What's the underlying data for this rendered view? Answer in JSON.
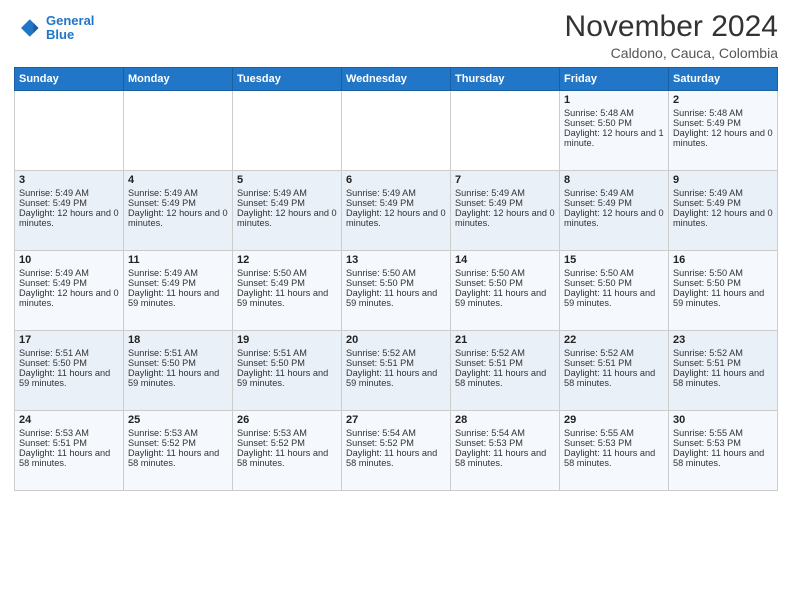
{
  "logo": {
    "line1": "General",
    "line2": "Blue"
  },
  "title": "November 2024",
  "subtitle": "Caldono, Cauca, Colombia",
  "days_of_week": [
    "Sunday",
    "Monday",
    "Tuesday",
    "Wednesday",
    "Thursday",
    "Friday",
    "Saturday"
  ],
  "weeks": [
    [
      {
        "day": "",
        "text": ""
      },
      {
        "day": "",
        "text": ""
      },
      {
        "day": "",
        "text": ""
      },
      {
        "day": "",
        "text": ""
      },
      {
        "day": "",
        "text": ""
      },
      {
        "day": "1",
        "text": "Sunrise: 5:48 AM\nSunset: 5:50 PM\nDaylight: 12 hours and 1 minute."
      },
      {
        "day": "2",
        "text": "Sunrise: 5:48 AM\nSunset: 5:49 PM\nDaylight: 12 hours and 0 minutes."
      }
    ],
    [
      {
        "day": "3",
        "text": "Sunrise: 5:49 AM\nSunset: 5:49 PM\nDaylight: 12 hours and 0 minutes."
      },
      {
        "day": "4",
        "text": "Sunrise: 5:49 AM\nSunset: 5:49 PM\nDaylight: 12 hours and 0 minutes."
      },
      {
        "day": "5",
        "text": "Sunrise: 5:49 AM\nSunset: 5:49 PM\nDaylight: 12 hours and 0 minutes."
      },
      {
        "day": "6",
        "text": "Sunrise: 5:49 AM\nSunset: 5:49 PM\nDaylight: 12 hours and 0 minutes."
      },
      {
        "day": "7",
        "text": "Sunrise: 5:49 AM\nSunset: 5:49 PM\nDaylight: 12 hours and 0 minutes."
      },
      {
        "day": "8",
        "text": "Sunrise: 5:49 AM\nSunset: 5:49 PM\nDaylight: 12 hours and 0 minutes."
      },
      {
        "day": "9",
        "text": "Sunrise: 5:49 AM\nSunset: 5:49 PM\nDaylight: 12 hours and 0 minutes."
      }
    ],
    [
      {
        "day": "10",
        "text": "Sunrise: 5:49 AM\nSunset: 5:49 PM\nDaylight: 12 hours and 0 minutes."
      },
      {
        "day": "11",
        "text": "Sunrise: 5:49 AM\nSunset: 5:49 PM\nDaylight: 11 hours and 59 minutes."
      },
      {
        "day": "12",
        "text": "Sunrise: 5:50 AM\nSunset: 5:49 PM\nDaylight: 11 hours and 59 minutes."
      },
      {
        "day": "13",
        "text": "Sunrise: 5:50 AM\nSunset: 5:50 PM\nDaylight: 11 hours and 59 minutes."
      },
      {
        "day": "14",
        "text": "Sunrise: 5:50 AM\nSunset: 5:50 PM\nDaylight: 11 hours and 59 minutes."
      },
      {
        "day": "15",
        "text": "Sunrise: 5:50 AM\nSunset: 5:50 PM\nDaylight: 11 hours and 59 minutes."
      },
      {
        "day": "16",
        "text": "Sunrise: 5:50 AM\nSunset: 5:50 PM\nDaylight: 11 hours and 59 minutes."
      }
    ],
    [
      {
        "day": "17",
        "text": "Sunrise: 5:51 AM\nSunset: 5:50 PM\nDaylight: 11 hours and 59 minutes."
      },
      {
        "day": "18",
        "text": "Sunrise: 5:51 AM\nSunset: 5:50 PM\nDaylight: 11 hours and 59 minutes."
      },
      {
        "day": "19",
        "text": "Sunrise: 5:51 AM\nSunset: 5:50 PM\nDaylight: 11 hours and 59 minutes."
      },
      {
        "day": "20",
        "text": "Sunrise: 5:52 AM\nSunset: 5:51 PM\nDaylight: 11 hours and 59 minutes."
      },
      {
        "day": "21",
        "text": "Sunrise: 5:52 AM\nSunset: 5:51 PM\nDaylight: 11 hours and 58 minutes."
      },
      {
        "day": "22",
        "text": "Sunrise: 5:52 AM\nSunset: 5:51 PM\nDaylight: 11 hours and 58 minutes."
      },
      {
        "day": "23",
        "text": "Sunrise: 5:52 AM\nSunset: 5:51 PM\nDaylight: 11 hours and 58 minutes."
      }
    ],
    [
      {
        "day": "24",
        "text": "Sunrise: 5:53 AM\nSunset: 5:51 PM\nDaylight: 11 hours and 58 minutes."
      },
      {
        "day": "25",
        "text": "Sunrise: 5:53 AM\nSunset: 5:52 PM\nDaylight: 11 hours and 58 minutes."
      },
      {
        "day": "26",
        "text": "Sunrise: 5:53 AM\nSunset: 5:52 PM\nDaylight: 11 hours and 58 minutes."
      },
      {
        "day": "27",
        "text": "Sunrise: 5:54 AM\nSunset: 5:52 PM\nDaylight: 11 hours and 58 minutes."
      },
      {
        "day": "28",
        "text": "Sunrise: 5:54 AM\nSunset: 5:53 PM\nDaylight: 11 hours and 58 minutes."
      },
      {
        "day": "29",
        "text": "Sunrise: 5:55 AM\nSunset: 5:53 PM\nDaylight: 11 hours and 58 minutes."
      },
      {
        "day": "30",
        "text": "Sunrise: 5:55 AM\nSunset: 5:53 PM\nDaylight: 11 hours and 58 minutes."
      }
    ]
  ]
}
